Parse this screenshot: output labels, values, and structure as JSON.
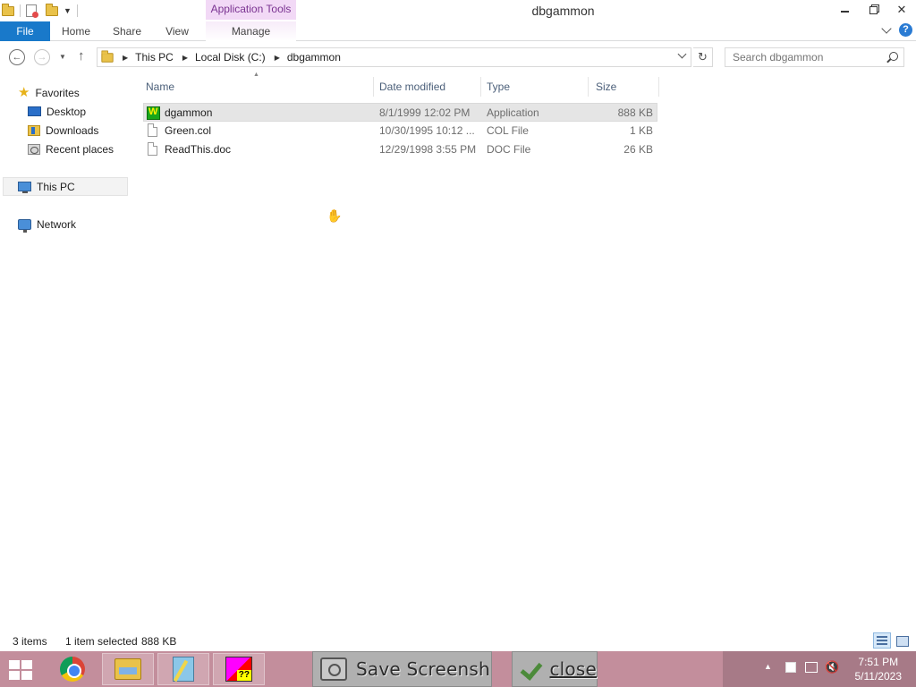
{
  "window": {
    "title": "dbgammon",
    "contextual_tab_group": "Application Tools",
    "minimize_label": "—",
    "close_label": "✕"
  },
  "ribbon": {
    "tabs": [
      {
        "label": "File"
      },
      {
        "label": "Home"
      },
      {
        "label": "Share"
      },
      {
        "label": "View"
      },
      {
        "label": "Manage"
      }
    ],
    "help_label": "?"
  },
  "address": {
    "breadcrumbs": [
      "This PC",
      "Local Disk (C:)",
      "dbgammon"
    ],
    "search_placeholder": "Search dbgammon"
  },
  "nav_pane": {
    "favorites": "Favorites",
    "desktop": "Desktop",
    "downloads": "Downloads",
    "recent": "Recent places",
    "this_pc": "This PC",
    "network": "Network"
  },
  "columns": {
    "name": "Name",
    "date": "Date modified",
    "type": "Type",
    "size": "Size"
  },
  "files": [
    {
      "name": "dgammon",
      "date": "8/1/1999 12:02 PM",
      "type": "Application",
      "size": "888 KB",
      "icon": "application-icon",
      "selected": true
    },
    {
      "name": "Green.col",
      "date": "10/30/1995 10:12 ...",
      "type": "COL File",
      "size": "1 KB",
      "icon": "file-icon",
      "selected": false
    },
    {
      "name": "ReadThis.doc",
      "date": "12/29/1998 3:55 PM",
      "type": "DOC File",
      "size": "26 KB",
      "icon": "document-icon",
      "selected": false
    }
  ],
  "status": {
    "item_count": "3 items",
    "selection": "1 item selected",
    "selection_size": "888 KB"
  },
  "taskbar": {
    "save_screenshot": "Save Screenshot",
    "close": "close",
    "game_icon_text": "??",
    "clock_time": "7:51 PM",
    "clock_date": "5/11/2023",
    "tray_arrow": "▲"
  },
  "colors": {
    "file_tab": "#1979ca",
    "app_tools": "#f2d9f6",
    "taskbar": "#c38e9c",
    "selection": "#e5e5e5"
  }
}
